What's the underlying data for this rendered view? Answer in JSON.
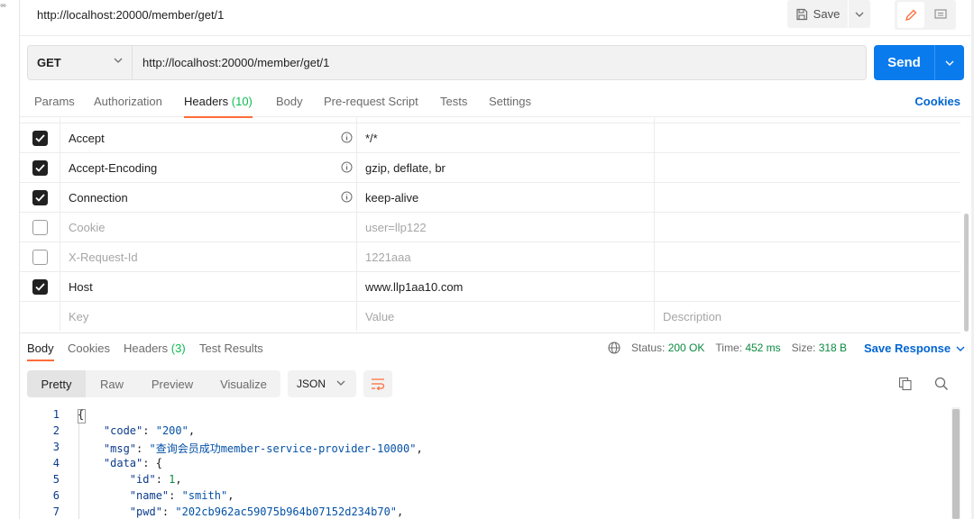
{
  "request": {
    "title": "http://localhost:20000/member/get/1",
    "save_label": "Save",
    "method": "GET",
    "url": "http://localhost:20000/member/get/1",
    "send_label": "Send"
  },
  "request_tabs": {
    "params": "Params",
    "authorization": "Authorization",
    "headers": "Headers",
    "headers_count": "(10)",
    "body": "Body",
    "prerequest": "Pre-request Script",
    "tests": "Tests",
    "settings": "Settings",
    "cookies": "Cookies"
  },
  "headers": [
    {
      "key": "Accept",
      "value": "*/*",
      "checked": true
    },
    {
      "key": "Accept-Encoding",
      "value": "gzip, deflate, br",
      "checked": true
    },
    {
      "key": "Connection",
      "value": "keep-alive",
      "checked": true
    },
    {
      "key": "Cookie",
      "value": "user=llp122",
      "checked": false
    },
    {
      "key": "X-Request-Id",
      "value": "1221aaa",
      "checked": false
    },
    {
      "key": "Host",
      "value": "www.llp1aa10.com",
      "checked": true
    }
  ],
  "headers_placeholders": {
    "key": "Key",
    "value": "Value",
    "description": "Description"
  },
  "response_tabs": {
    "body": "Body",
    "cookies": "Cookies",
    "headers": "Headers",
    "headers_count": "(3)",
    "test_results": "Test Results"
  },
  "status": {
    "status_label": "Status:",
    "status_value": "200 OK",
    "time_label": "Time:",
    "time_value": "452 ms",
    "size_label": "Size:",
    "size_value": "318 B",
    "save_response": "Save Response"
  },
  "response_view": {
    "formats": [
      "Pretty",
      "Raw",
      "Preview",
      "Visualize"
    ],
    "language": "JSON"
  },
  "response_body": {
    "line_numbers": [
      "1",
      "2",
      "3",
      "4",
      "5",
      "6",
      "7"
    ],
    "code_key": "\"code\"",
    "code_value": "\"200\"",
    "msg_key": "\"msg\"",
    "msg_value": "\"查询会员成功member-service-provider-10000\"",
    "data_key": "\"data\"",
    "id_key": "\"id\"",
    "id_value": "1",
    "name_key": "\"name\"",
    "name_value": "\"smith\"",
    "pwd_key": "\"pwd\"",
    "pwd_value": "\"202cb962ac59075b964b07152d234b70\""
  },
  "colors": {
    "accent": "#ff6c37",
    "send": "#097bed",
    "link": "#0265d2",
    "success": "#0a8a3f"
  }
}
